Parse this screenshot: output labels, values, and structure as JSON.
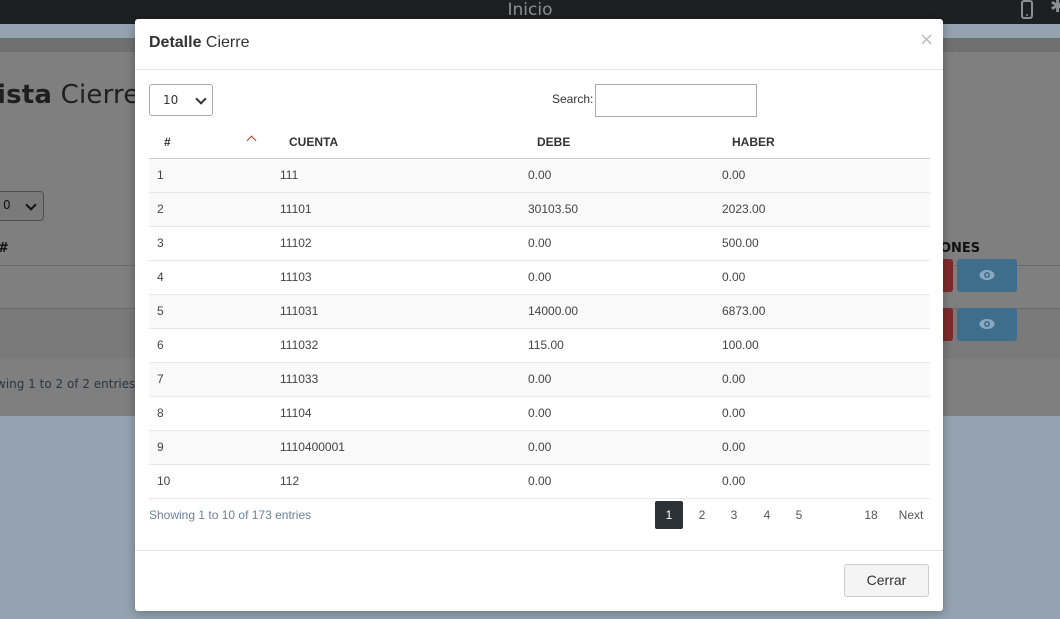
{
  "topbar": {
    "title": "Inicio"
  },
  "background": {
    "heading_bold": "ista",
    "heading_rest": "Cierres",
    "length_value": "0",
    "col_hash": "#",
    "col_actions": "ONES",
    "info": "wing 1 to 2 of 2 entries"
  },
  "modal": {
    "title_bold": "Detalle",
    "title_rest": "Cierre",
    "close_glyph": "×",
    "length_value": "10",
    "search_label": "Search:",
    "search_value": "",
    "columns": [
      "#",
      "CUENTA",
      "DEBE",
      "HABER"
    ],
    "rows": [
      {
        "n": "1",
        "cuenta": "111",
        "debe": "0.00",
        "haber": "0.00"
      },
      {
        "n": "2",
        "cuenta": "11101",
        "debe": "30103.50",
        "haber": "2023.00"
      },
      {
        "n": "3",
        "cuenta": "11102",
        "debe": "0.00",
        "haber": "500.00"
      },
      {
        "n": "4",
        "cuenta": "11103",
        "debe": "0.00",
        "haber": "0.00"
      },
      {
        "n": "5",
        "cuenta": "111031",
        "debe": "14000.00",
        "haber": "6873.00"
      },
      {
        "n": "6",
        "cuenta": "111032",
        "debe": "115.00",
        "haber": "100.00"
      },
      {
        "n": "7",
        "cuenta": "111033",
        "debe": "0.00",
        "haber": "0.00"
      },
      {
        "n": "8",
        "cuenta": "11104",
        "debe": "0.00",
        "haber": "0.00"
      },
      {
        "n": "9",
        "cuenta": "1110400001",
        "debe": "0.00",
        "haber": "0.00"
      },
      {
        "n": "10",
        "cuenta": "112",
        "debe": "0.00",
        "haber": "0.00"
      }
    ],
    "info": "Showing 1 to 10 of 173 entries",
    "pagination": {
      "pages": [
        "1",
        "2",
        "3",
        "4",
        "5"
      ],
      "last": "18",
      "next": "Next",
      "active": "1"
    },
    "close_button": "Cerrar"
  }
}
